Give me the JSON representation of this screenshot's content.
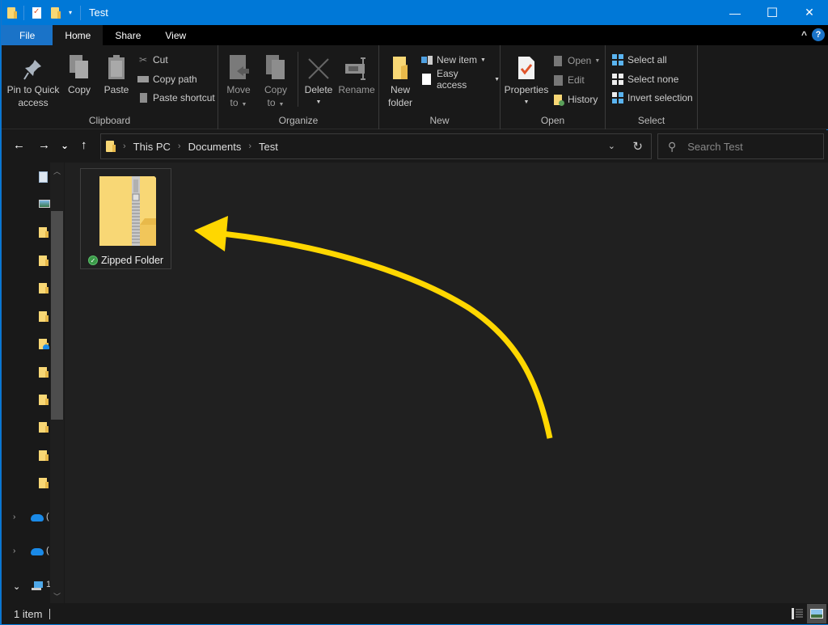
{
  "window": {
    "title": "Test",
    "controls": {
      "minimize": "—",
      "maximize": "☐",
      "close": "✕"
    }
  },
  "quick_access_toolbar": {
    "items": [
      "folder-icon",
      "properties-icon",
      "new-folder-icon"
    ],
    "dropdown": "▾"
  },
  "tabs": [
    {
      "label": "File",
      "active": false
    },
    {
      "label": "Home",
      "active": true
    },
    {
      "label": "Share",
      "active": false
    },
    {
      "label": "View",
      "active": false
    }
  ],
  "ribbon": {
    "collapse_glyph": "^",
    "help_glyph": "?",
    "groups": {
      "clipboard": {
        "label": "Clipboard",
        "pin_label_1": "Pin to Quick",
        "pin_label_2": "access",
        "copy": "Copy",
        "paste": "Paste",
        "cut": "Cut",
        "copy_path": "Copy path",
        "paste_shortcut": "Paste shortcut"
      },
      "organize": {
        "label": "Organize",
        "move_to_1": "Move",
        "move_to_2": "to",
        "copy_to_1": "Copy",
        "copy_to_2": "to",
        "delete": "Delete",
        "rename": "Rename"
      },
      "new": {
        "label": "New",
        "new_folder_1": "New",
        "new_folder_2": "folder",
        "new_item": "New item",
        "easy_access": "Easy access"
      },
      "open": {
        "label": "Open",
        "properties": "Properties",
        "open": "Open",
        "edit": "Edit",
        "history": "History"
      },
      "select": {
        "label": "Select",
        "select_all": "Select all",
        "select_none": "Select none",
        "invert_selection": "Invert selection"
      }
    }
  },
  "navigation": {
    "back": "←",
    "forward": "→",
    "recent": "⌄",
    "up": "↑",
    "breadcrumb": [
      "This PC",
      "Documents",
      "Test"
    ],
    "breadcrumb_sep": "›",
    "dropdown": "⌄",
    "refresh": "↻",
    "search_placeholder": "Search Test"
  },
  "nav_pane": {
    "expand_collapsed": "›",
    "expand_open": "⌄",
    "truncated_items": [
      "(",
      "(",
      "1"
    ]
  },
  "content": {
    "items": [
      {
        "name": "Zipped Folder",
        "type": "compressed-folder",
        "sync_status": "available"
      }
    ],
    "annotation_color": "#FFD700"
  },
  "status_bar": {
    "item_count": "1 item"
  },
  "colors": {
    "accent": "#0078d7",
    "background": "#202020",
    "folder": "#f8d775",
    "annotation_arrow": "#FFD700"
  }
}
